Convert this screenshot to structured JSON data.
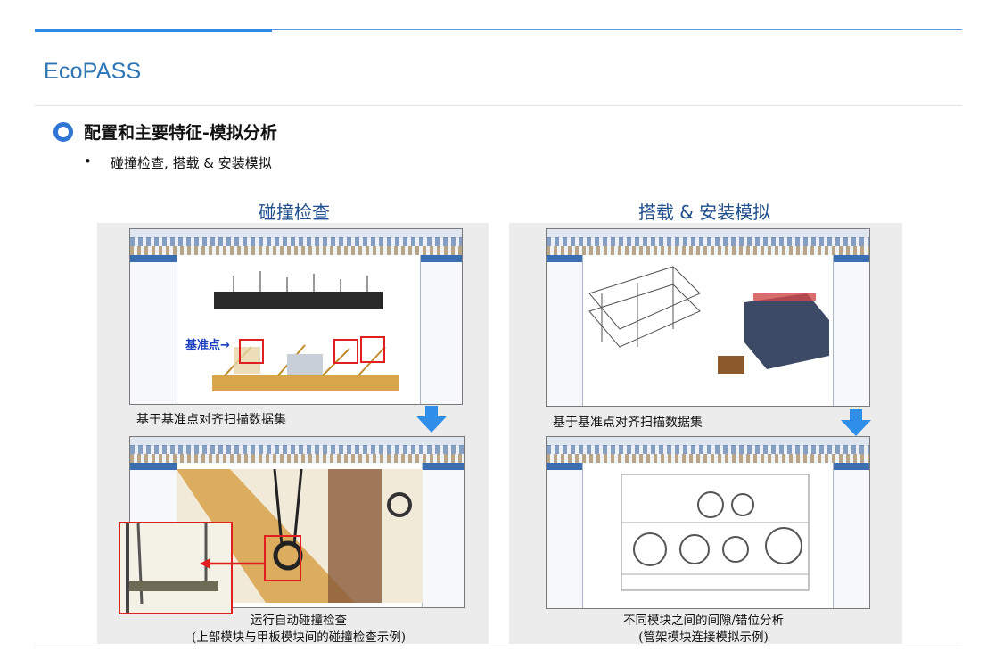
{
  "brand": "EcoPASS",
  "heading": "配置和主要特征-模拟分析",
  "bullet": "碰撞检查, 搭载 & 安装模拟",
  "left": {
    "title": "碰撞检查",
    "caption_top": "基于基准点对齐扫描数据集",
    "marker_label": "基准点→",
    "caption_bottom_1": "运行自动碰撞检查",
    "caption_bottom_2": "(上部模块与甲板模块间的碰撞检查示例)"
  },
  "right": {
    "title": "搭载 & 安装模拟",
    "caption_top": "基于基准点对齐扫描数据集",
    "caption_bottom_1": "不同模块之间的间隙/错位分析",
    "caption_bottom_2": "(管架模块连接模拟示例)"
  },
  "colors": {
    "accent": "#2e8ae6",
    "brand": "#2e75b6",
    "arrow": "#2f8ee8",
    "highlight": "#e02020"
  }
}
